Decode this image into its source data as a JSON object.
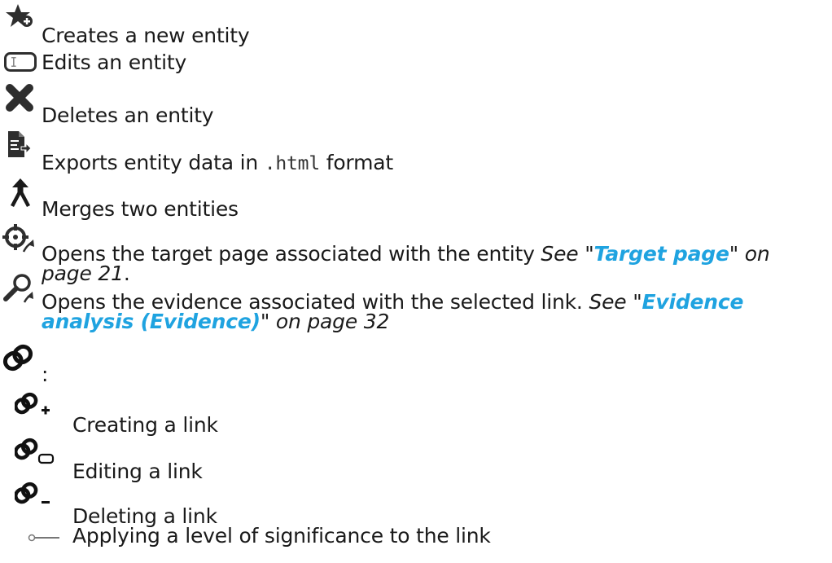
{
  "items": [
    {
      "icon": "star-plus-icon",
      "text": "Creates a new entity"
    },
    {
      "icon": "edit-field-icon",
      "text": "Edits an entity"
    },
    {
      "icon": "delete-x-icon",
      "text": "Deletes an entity"
    },
    {
      "icon": "export-doc-icon",
      "text_before": "Exports entity data in ",
      "code": ".html",
      "text_after": " format"
    },
    {
      "icon": "merge-arrow-icon",
      "text": "Merges two entities"
    },
    {
      "icon": "target-page-icon",
      "text": "Opens the target page associated with the entity ",
      "ref_prefix": "See \"",
      "ref_link": "Target page",
      "ref_suffix": "\" on page 21",
      "trail": "."
    },
    {
      "icon": "evidence-search-icon",
      "text": "Opens the evidence associated with the selected link. ",
      "ref_prefix": "See \"",
      "ref_link": "Evidence analysis (Evidence)",
      "ref_suffix": "\" on page 32"
    },
    {
      "icon": "link-chain-icon",
      "text": ":"
    }
  ],
  "subitems": [
    {
      "icon": "link-add-icon",
      "text": "Creating a link"
    },
    {
      "icon": "link-edit-icon",
      "text": "Editing a link"
    },
    {
      "icon": "link-delete-icon",
      "text": "Deleting a link"
    },
    {
      "icon": "significance-slider-icon",
      "text": "Applying a level of significance to the link"
    }
  ]
}
